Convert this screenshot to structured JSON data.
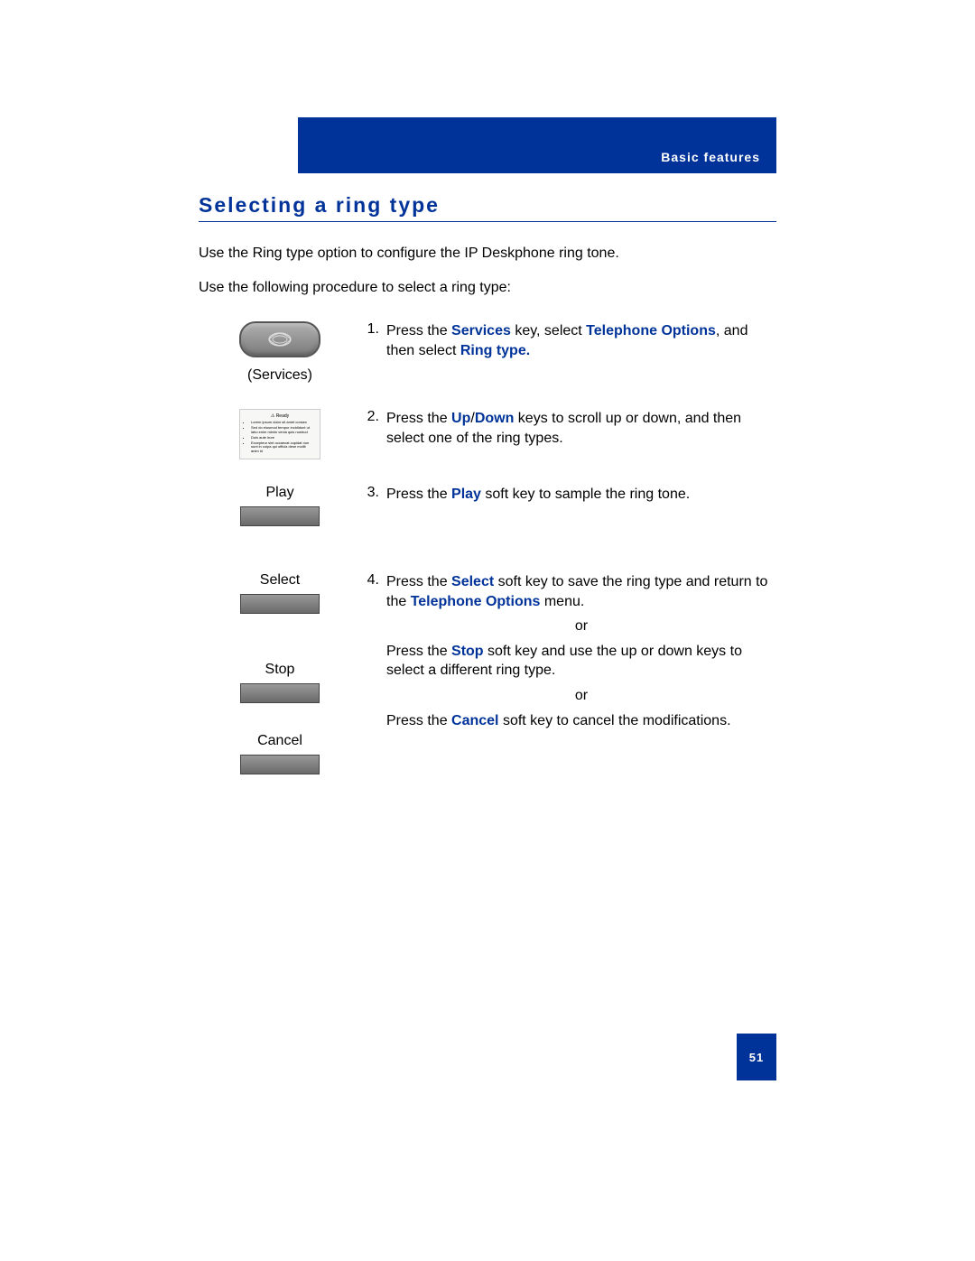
{
  "header": {
    "section_label": "Basic features"
  },
  "title": "Selecting a ring type",
  "intro1": "Use the Ring type option to configure the IP Deskphone ring tone.",
  "intro2": "Use the following procedure to select a ring type:",
  "left": {
    "services_label": "(Services)",
    "play_label": "Play",
    "select_label": "Select",
    "stop_label": "Stop",
    "cancel_label": "Cancel"
  },
  "steps": {
    "s1": {
      "num": "1.",
      "t1": "Press the ",
      "k1": "Services",
      "t2": " key, select ",
      "k2": "Telephone Options",
      "t3": ", and then select ",
      "k3": "Ring type."
    },
    "s2": {
      "num": "2.",
      "t1": "Press the ",
      "k1": "Up",
      "slash": "/",
      "k2": "Down",
      "t2": " keys to scroll up or down, and then select one of the ring types."
    },
    "s3": {
      "num": "3.",
      "t1": "Press the ",
      "k1": "Play",
      "t2": " soft key to sample the ring tone."
    },
    "s4": {
      "num": "4.",
      "t1": "Press the ",
      "k1": "Select",
      "t2": " soft key to save the ring type and return to the ",
      "k2": "Telephone Options",
      "t3": " menu.",
      "or1": "or",
      "stop_t1": "Press the ",
      "stop_k1": "Stop",
      "stop_t2": " soft key and use the up or down keys to select a different ring type.",
      "or2": "or",
      "cancel_t1": "Press the ",
      "cancel_k1": "Cancel",
      "cancel_t2": " soft key to cancel the modifications."
    }
  },
  "page_number": "51"
}
